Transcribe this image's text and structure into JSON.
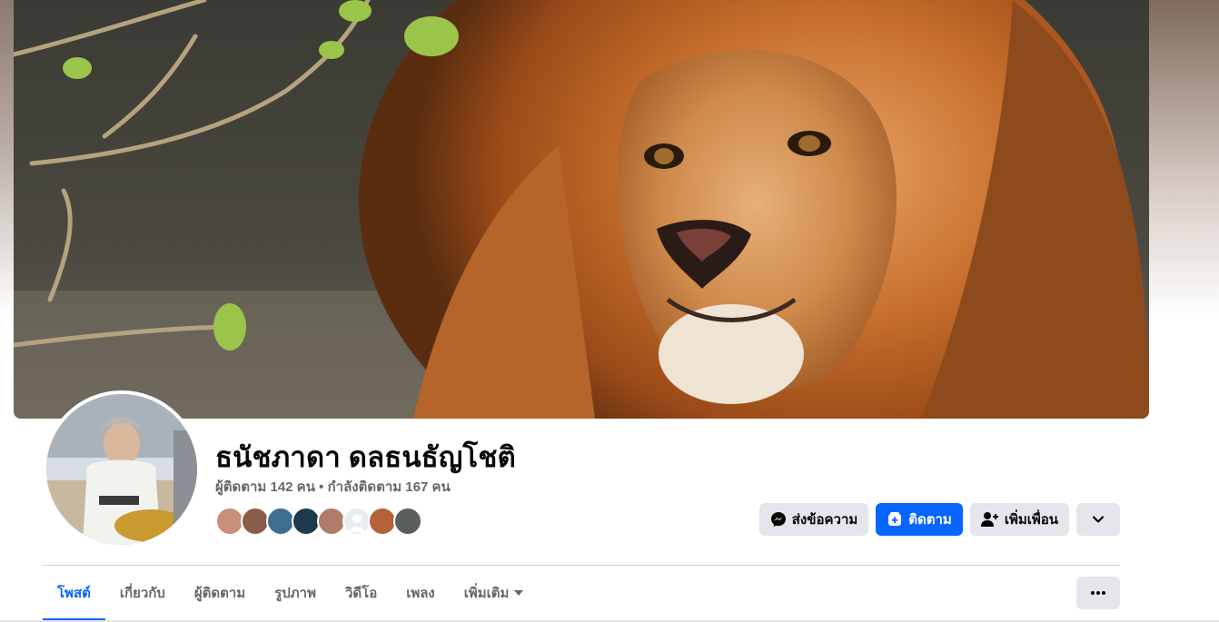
{
  "profile": {
    "name": "ธนัชภาดา ดลธนธัญโชติ",
    "followers_text": "ผู้ติดตาม 142 คน",
    "separator": " • ",
    "following_text": "กำลังติดตาม 167 คน"
  },
  "actions": {
    "message_label": "ส่งข้อความ",
    "follow_label": "ติดตาม",
    "add_friend_label": "เพิ่มเพื่อน"
  },
  "tabs": [
    {
      "label": "โพสต์",
      "active": true
    },
    {
      "label": "เกี่ยวกับ",
      "active": false
    },
    {
      "label": "ผู้ติดตาม",
      "active": false
    },
    {
      "label": "รูปภาพ",
      "active": false
    },
    {
      "label": "วิดีโอ",
      "active": false
    },
    {
      "label": "เพลง",
      "active": false
    },
    {
      "label": "เพิ่มเติม",
      "active": false
    }
  ],
  "friend_faces_colors": [
    "#c98f7a",
    "#8a5c4a",
    "#3d6d8f",
    "#1f3a4d",
    "#b07c6a",
    "#e9ecef",
    "#b5623a",
    "#5a5e5c"
  ],
  "colors": {
    "accent": "#0866ff",
    "secondary_button": "#e4e6eb",
    "muted_text": "#65676b"
  },
  "icons": {
    "message": "messenger-icon",
    "follow": "follow-icon",
    "add_friend": "add-friend-icon",
    "dropdown": "chevron-down-icon",
    "more": "ellipsis-icon"
  }
}
